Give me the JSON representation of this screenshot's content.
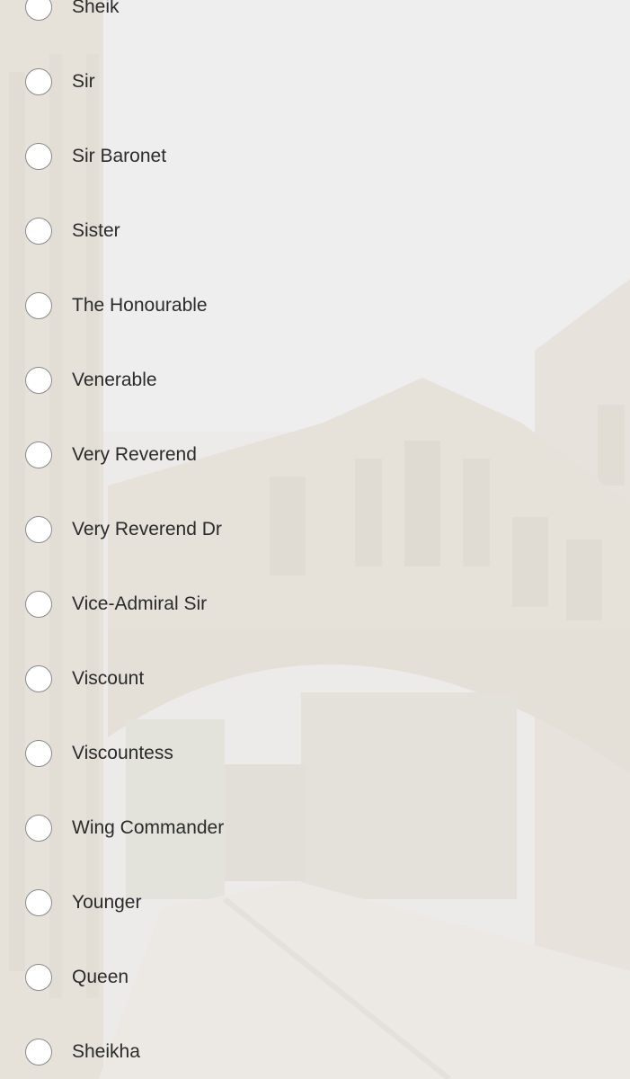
{
  "options": [
    {
      "label": "Sheik",
      "selected": false
    },
    {
      "label": "Sir",
      "selected": false
    },
    {
      "label": "Sir Baronet",
      "selected": false
    },
    {
      "label": "Sister",
      "selected": false
    },
    {
      "label": "The Honourable",
      "selected": false
    },
    {
      "label": "Venerable",
      "selected": false
    },
    {
      "label": "Very Reverend",
      "selected": false
    },
    {
      "label": "Very Reverend Dr",
      "selected": false
    },
    {
      "label": "Vice-Admiral Sir",
      "selected": false
    },
    {
      "label": "Viscount",
      "selected": false
    },
    {
      "label": "Viscountess",
      "selected": false
    },
    {
      "label": "Wing Commander",
      "selected": false
    },
    {
      "label": "Younger",
      "selected": false
    },
    {
      "label": "Queen",
      "selected": false
    },
    {
      "label": "Sheikha",
      "selected": false
    }
  ],
  "colors": {
    "text": "#2b2b2b",
    "radio_border": "#8a8a8a",
    "radio_fill": "#ffffff"
  }
}
